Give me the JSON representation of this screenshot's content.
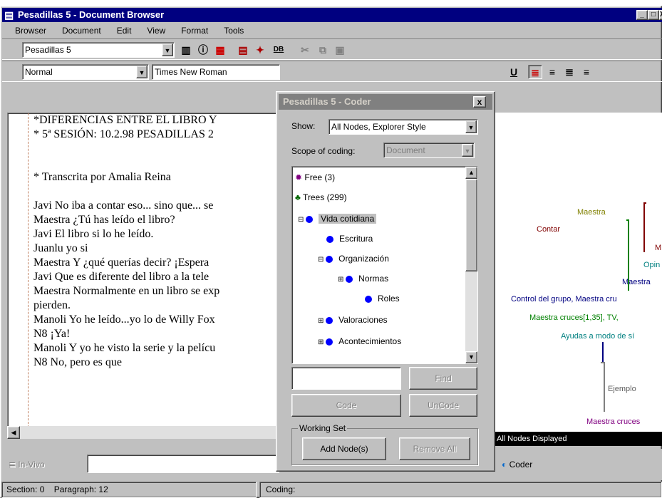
{
  "window": {
    "title": "Pesadillas 5 - Document Browser",
    "min": "_",
    "max": "□",
    "close": "X"
  },
  "menu": [
    "Browser",
    "Document",
    "Edit",
    "View",
    "Format",
    "Tools"
  ],
  "toolbar1": {
    "doc_combo": "Pesadillas 5"
  },
  "toolbar2": {
    "style_combo": "Normal",
    "font_combo": "Times New Roman",
    "underline": "U"
  },
  "document": {
    "lines": [
      "*DIFERENCIAS ENTRE EL LIBRO Y",
      "* 5ª SESIÓN: 10.2.98  PESADILLAS 2",
      "",
      "",
      "* Transcrita por Amalia Reina",
      "",
      "Javi No iba a contar eso... sino que... se",
      "Maestra ¿Tú has leído el libro?",
      "Javi El libro si lo he leído.",
      "Juanlu   yo si",
      "Maestra Y ¿qué querías decir? ¡Espera",
      "Javi Que es diferente del libro a la tele",
      "Maestra Normalmente en un libro se exp",
      "pierden.",
      "Manoli   Yo he leído...yo lo de Willy Fox",
      "N8  ¡Ya!",
      "Manoli   Y yo he visto la serie y la pelícu",
      "N8  No, pero es que"
    ]
  },
  "coder": {
    "title": "Pesadillas 5 - Coder",
    "close": "x",
    "show_label": "Show:",
    "show_value": "All Nodes, Explorer Style",
    "scope_label": "Scope of coding:",
    "scope_value": "Document",
    "tree": [
      {
        "label": "Free (3)"
      },
      {
        "label": "Trees (299)"
      },
      {
        "label": "Vida cotidiana"
      },
      {
        "label": "Escritura"
      },
      {
        "label": "Organización"
      },
      {
        "label": "Normas"
      },
      {
        "label": "Roles"
      },
      {
        "label": "Valoraciones"
      },
      {
        "label": "Acontecimientos"
      }
    ],
    "find": "Find",
    "code": "Code",
    "uncode": "UnCode",
    "working_set": "Working Set",
    "add_nodes": "Add Node(s)",
    "remove_all": "Remove All"
  },
  "explorer": {
    "labels": [
      "Maestra",
      "Contar",
      "M",
      "Opin",
      "Maestra",
      "Control del grupo, Maestra cru",
      "Maestra cruces[1,35], TV,",
      "Ayudas a modo de sí",
      "Ejemplo",
      "Maestra cruces"
    ],
    "footer": "All Nodes Displayed"
  },
  "invivo": {
    "label": "In-Vivo",
    "coder_btn": "Coder"
  },
  "status": {
    "section": "Section: 0",
    "paragraph": "Paragraph: 12",
    "coding": "Coding:"
  }
}
